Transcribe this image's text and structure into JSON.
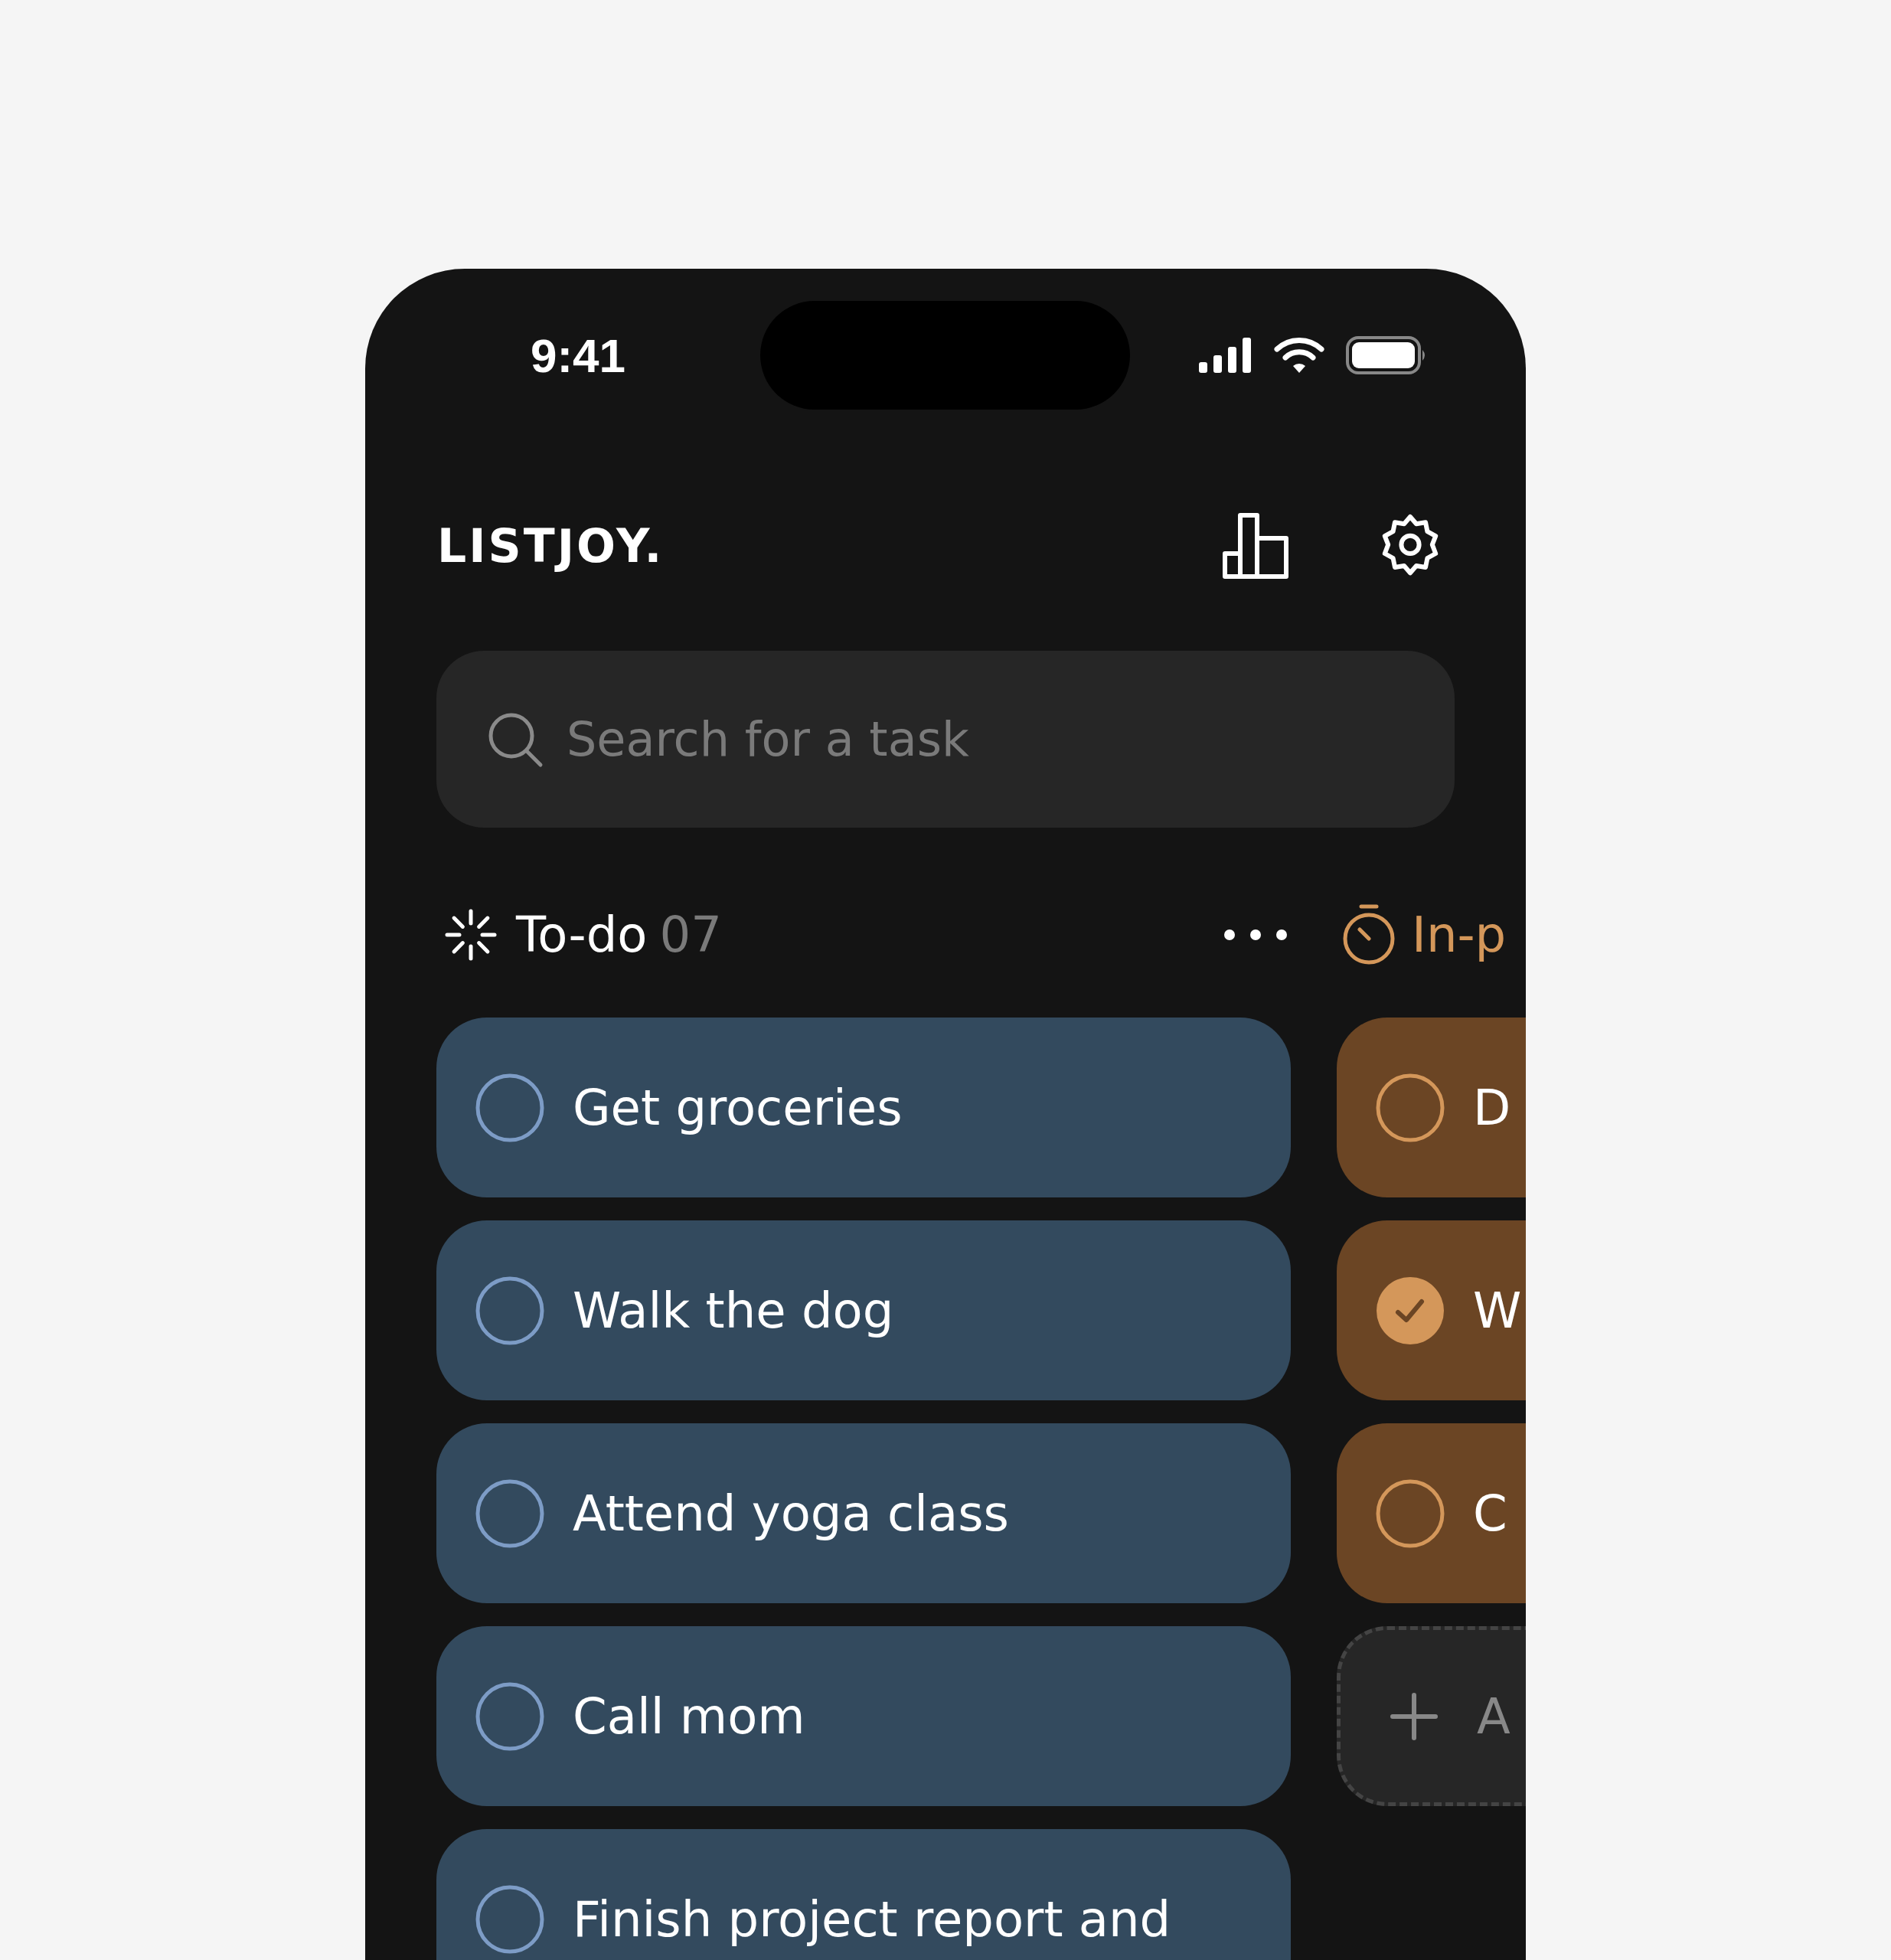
{
  "status_bar": {
    "time": "9:41"
  },
  "app": {
    "title": "LISTJOY."
  },
  "search": {
    "placeholder": "Search for a task"
  },
  "columns": [
    {
      "kind": "todo",
      "title": "To-do",
      "count": "07",
      "tasks": [
        {
          "title": "Get groceries",
          "checked": false
        },
        {
          "title": "Walk the dog",
          "checked": false
        },
        {
          "title": "Attend yoga class",
          "checked": false
        },
        {
          "title": "Call mom",
          "checked": false
        },
        {
          "title": "Finish project report and",
          "checked": false
        }
      ]
    },
    {
      "kind": "in_progress",
      "title": "In-p",
      "tasks": [
        {
          "title": "D",
          "checked": false
        },
        {
          "title": "W",
          "checked": true
        },
        {
          "title": "C",
          "checked": false
        }
      ],
      "add_label": "A"
    }
  ]
}
